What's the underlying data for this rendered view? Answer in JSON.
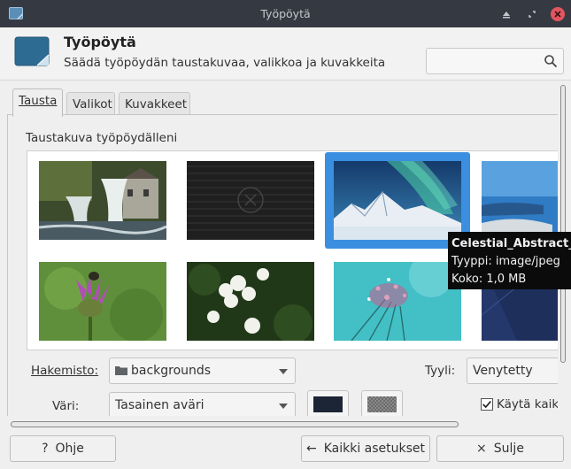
{
  "window": {
    "title": "Työpöytä",
    "header_title": "Työpöytä",
    "header_subtitle": "Säädä työpöydän taustakuvaa, valikkoa ja kuvakkeita",
    "search_placeholder": ""
  },
  "tabs": [
    {
      "label": "Tausta",
      "active": true
    },
    {
      "label": "Valikot",
      "active": false
    },
    {
      "label": "Kuvakkeet",
      "active": false
    }
  ],
  "background": {
    "section_label": "Taustakuva työpöydälleni",
    "wallpapers": [
      {
        "name": "waterfall-mill",
        "selected": false
      },
      {
        "name": "dark-stripes",
        "selected": false
      },
      {
        "name": "Celestial_Abstract_L",
        "selected": true
      },
      {
        "name": "coast",
        "selected": false
      },
      {
        "name": "thistle-bee",
        "selected": false
      },
      {
        "name": "white-flowers",
        "selected": false
      },
      {
        "name": "dandelion-droplets",
        "selected": false
      },
      {
        "name": "navy-geometric",
        "selected": false
      }
    ],
    "folder_label": "Hakemisto:",
    "folder_value": "backgrounds",
    "style_label": "Tyyli:",
    "style_value": "Venytetty",
    "color_label": "Väri:",
    "color_value": "Tasainen aväri",
    "primary_color": "#1b2535",
    "checkbox_label": "Käytä kaik",
    "checkbox_checked": true
  },
  "tooltip": {
    "name": "Celestial_Abstract_L",
    "type": "Tyyppi: image/jpeg",
    "size": "Koko: 1,0 MB"
  },
  "buttons": {
    "help": "Ohje",
    "all_settings": "Kaikki asetukset",
    "close": "Sulje"
  },
  "colors": {
    "selection": "#3b8fe0",
    "titlebar": "#353a42",
    "close_button": "#e0555f"
  }
}
